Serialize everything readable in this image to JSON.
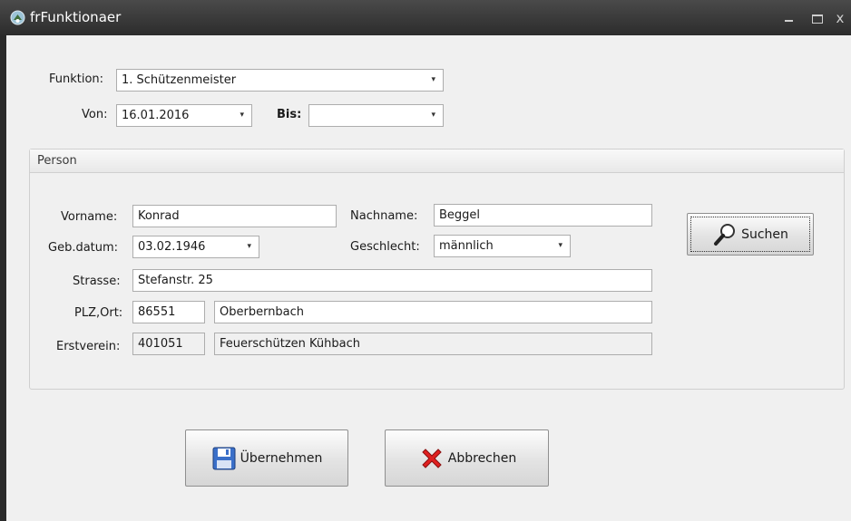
{
  "window": {
    "title": "frFunktionaer",
    "minimize_glyph": "_",
    "close_glyph": "x"
  },
  "header_form": {
    "funktion_label": "Funktion:",
    "funktion_value": "1. Schützenmeister",
    "von_label": "Von:",
    "von_value": "16.01.2016",
    "bis_label": "Bis:",
    "bis_value": ""
  },
  "person": {
    "group_title": "Person",
    "vorname_label": "Vorname:",
    "vorname_value": "Konrad",
    "nachname_label": "Nachname:",
    "nachname_value": "Beggel",
    "geburtsdatum_label": "Geb.datum:",
    "geburtsdatum_value": "03.02.1946",
    "geschlecht_label": "Geschlecht:",
    "geschlecht_value": "männlich",
    "strasse_label": "Strasse:",
    "strasse_value": "Stefanstr. 25",
    "plz_ort_label": "PLZ,Ort:",
    "plz_value": "86551",
    "ort_value": "Oberbernbach",
    "erstverein_label": "Erstverein:",
    "erstverein_nr": "401051",
    "erstverein_name": "Feuerschützen Kühbach",
    "search_label": "Suchen"
  },
  "actions": {
    "ok_label": "Übernehmen",
    "cancel_label": "Abbrechen"
  },
  "icons": {
    "app": "shield-icon",
    "search": "magnifier-icon",
    "save": "floppy-disk-icon",
    "cancel": "red-x-icon"
  },
  "colors": {
    "titlebar": "#353535",
    "window_bg": "#f0f0f0",
    "cancel_icon": "#e02020",
    "save_icon": "#3a6fc9"
  }
}
